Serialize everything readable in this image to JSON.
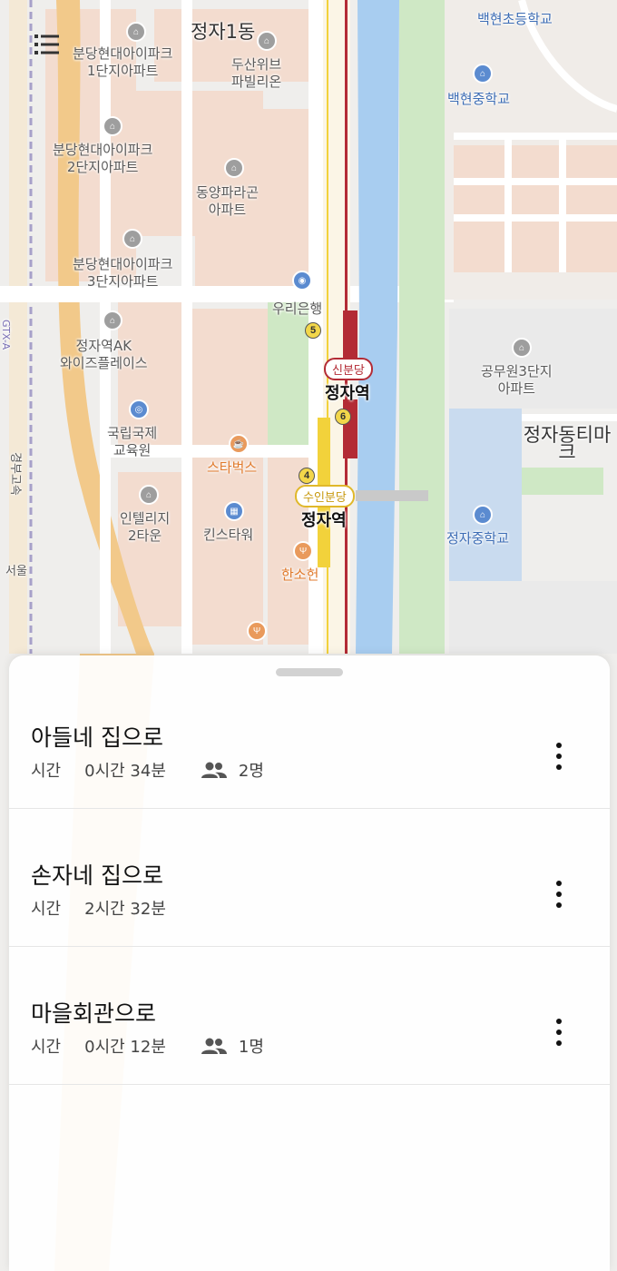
{
  "map": {
    "labels": {
      "jeongja1": "정자1동",
      "apt_park1": "분당현대아이파크\n1단지아파트",
      "doosan": "두산위브\n파빌리온",
      "apt_park2": "분당현대아이파크\n2단지아파트",
      "dongyang": "동양파라곤\n아파트",
      "apt_park3": "분당현대아이파크\n3단지아파트",
      "woori": "우리은행",
      "ak": "정자역AK\n와이즈플레이스",
      "gukje": "국립국제\n교육원",
      "starbucks": "스타벅스",
      "intelligent": "인텔리지\n2타운",
      "kins": "킨스타워",
      "hansoheon": "한소헌",
      "baekhyun_elem": "백현초등학교",
      "baekhyun_mid": "백현중학교",
      "gongmu": "공무원3단지\n아파트",
      "jeongja_mid": "정자중학교",
      "jeongja_apt": "정자동티마크",
      "station1": "정자역",
      "station2": "정자역",
      "line_shinbundang": "신분당",
      "line_suinbundang": "수인분당",
      "gtx": "GTX-A",
      "seoul": "서울",
      "expressway": "경부고속",
      "exit5": "5",
      "exit6": "6",
      "exit4": "4"
    }
  },
  "menu": {
    "icon": "menu-list-icon"
  },
  "routes": [
    {
      "name": "아들네 집으로",
      "time_label": "시간",
      "time": "0시간 34분",
      "people": "2명"
    },
    {
      "name": "손자네 집으로",
      "time_label": "시간",
      "time": "2시간 32분",
      "people": null
    },
    {
      "name": "마을회관으로",
      "time_label": "시간",
      "time": "0시간 12분",
      "people": "1명"
    }
  ],
  "colors": {
    "water": "#a8cdf0",
    "park": "#cfe8c5",
    "block": "#f3dccf",
    "road": "#ffffff",
    "highway": "#f2c98a",
    "line_shinbundang": "#b32b35",
    "line_suinbundang": "#f2d23b"
  }
}
